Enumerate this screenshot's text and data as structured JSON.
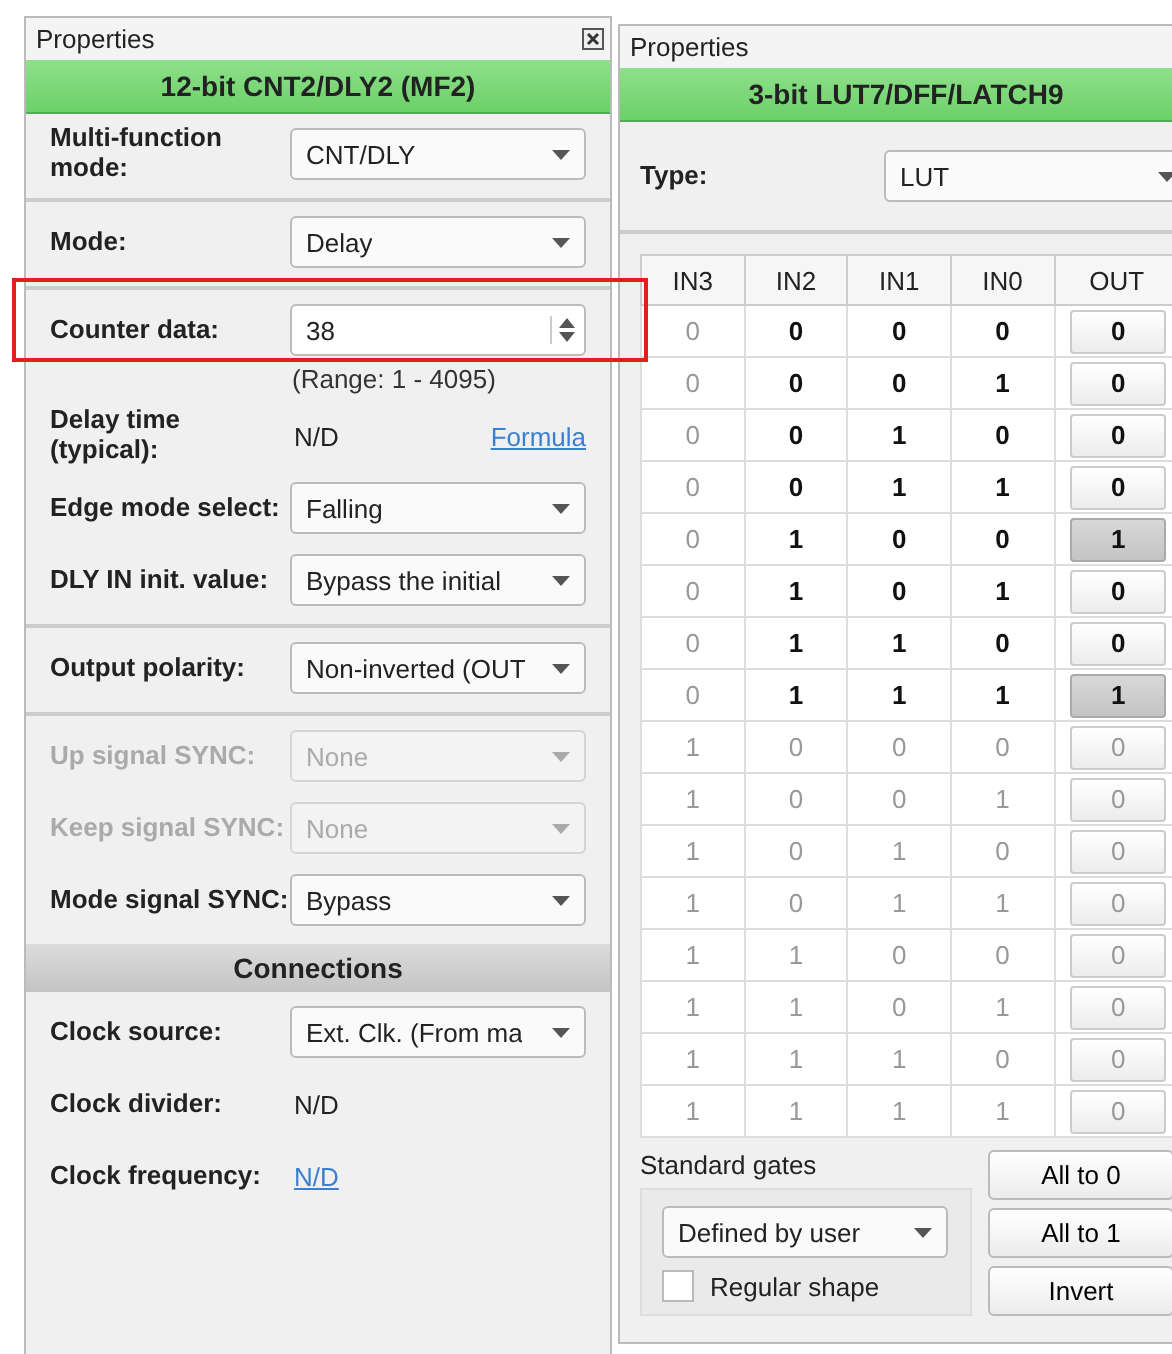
{
  "left_panel": {
    "title": "Properties",
    "header": "12-bit CNT2/DLY2 (MF2)",
    "groups": [
      {
        "fields": [
          {
            "kind": "dropdown",
            "label": "Multi-function mode:",
            "value": "CNT/DLY",
            "disabled": false
          }
        ]
      },
      {
        "fields": [
          {
            "kind": "dropdown",
            "label": "Mode:",
            "value": "Delay",
            "disabled": false
          }
        ]
      },
      {
        "fields": [
          {
            "kind": "spinbox",
            "label": "Counter data:",
            "value": "38",
            "hint": "(Range:  1 - 4095)",
            "highlighted": true
          },
          {
            "kind": "readout",
            "label": "Delay time (typical):",
            "value": "N/D",
            "link": "Formula"
          },
          {
            "kind": "dropdown",
            "label": "Edge mode select:",
            "value": "Falling",
            "disabled": false
          },
          {
            "kind": "dropdown",
            "label": "DLY IN init. value:",
            "value": "Bypass the initial",
            "disabled": false
          }
        ]
      },
      {
        "fields": [
          {
            "kind": "dropdown",
            "label": "Output polarity:",
            "value": "Non-inverted (OUT",
            "disabled": false
          }
        ]
      },
      {
        "fields": [
          {
            "kind": "dropdown",
            "label": "Up signal SYNC:",
            "value": "None",
            "disabled": true
          },
          {
            "kind": "dropdown",
            "label": "Keep signal SYNC:",
            "value": "None",
            "disabled": true
          },
          {
            "kind": "dropdown",
            "label": "Mode signal SYNC:",
            "value": "Bypass",
            "disabled": false
          }
        ]
      },
      {
        "heading": "Connections",
        "fields": [
          {
            "kind": "dropdown",
            "label": "Clock source:",
            "value": "Ext. Clk. (From ma",
            "disabled": false
          },
          {
            "kind": "readout",
            "label": "Clock divider:",
            "value": "N/D"
          },
          {
            "kind": "link",
            "label": "Clock frequency:",
            "value": "N/D"
          }
        ]
      }
    ]
  },
  "right_panel": {
    "title": "Properties",
    "header": "3-bit LUT7/DFF/LATCH9",
    "type_label": "Type:",
    "type_value": "LUT",
    "table": {
      "columns": [
        "IN3",
        "IN2",
        "IN1",
        "IN0",
        "OUT"
      ],
      "rows": [
        {
          "inputs": [
            "0",
            "0",
            "0",
            "0"
          ],
          "out": "0",
          "on": false,
          "active": true
        },
        {
          "inputs": [
            "0",
            "0",
            "0",
            "1"
          ],
          "out": "0",
          "on": false,
          "active": true
        },
        {
          "inputs": [
            "0",
            "0",
            "1",
            "0"
          ],
          "out": "0",
          "on": false,
          "active": true
        },
        {
          "inputs": [
            "0",
            "0",
            "1",
            "1"
          ],
          "out": "0",
          "on": false,
          "active": true
        },
        {
          "inputs": [
            "0",
            "1",
            "0",
            "0"
          ],
          "out": "1",
          "on": true,
          "active": true
        },
        {
          "inputs": [
            "0",
            "1",
            "0",
            "1"
          ],
          "out": "0",
          "on": false,
          "active": true
        },
        {
          "inputs": [
            "0",
            "1",
            "1",
            "0"
          ],
          "out": "0",
          "on": false,
          "active": true
        },
        {
          "inputs": [
            "0",
            "1",
            "1",
            "1"
          ],
          "out": "1",
          "on": true,
          "active": true
        },
        {
          "inputs": [
            "1",
            "0",
            "0",
            "0"
          ],
          "out": "0",
          "on": false,
          "active": false
        },
        {
          "inputs": [
            "1",
            "0",
            "0",
            "1"
          ],
          "out": "0",
          "on": false,
          "active": false
        },
        {
          "inputs": [
            "1",
            "0",
            "1",
            "0"
          ],
          "out": "0",
          "on": false,
          "active": false
        },
        {
          "inputs": [
            "1",
            "0",
            "1",
            "1"
          ],
          "out": "0",
          "on": false,
          "active": false
        },
        {
          "inputs": [
            "1",
            "1",
            "0",
            "0"
          ],
          "out": "0",
          "on": false,
          "active": false
        },
        {
          "inputs": [
            "1",
            "1",
            "0",
            "1"
          ],
          "out": "0",
          "on": false,
          "active": false
        },
        {
          "inputs": [
            "1",
            "1",
            "1",
            "0"
          ],
          "out": "0",
          "on": false,
          "active": false
        },
        {
          "inputs": [
            "1",
            "1",
            "1",
            "1"
          ],
          "out": "0",
          "on": false,
          "active": false
        }
      ]
    },
    "standard_gates": {
      "label": "Standard gates",
      "value": "Defined by user",
      "checkbox": {
        "label": "Regular shape",
        "checked": false
      }
    },
    "buttons": [
      "All to 0",
      "All to 1",
      "Invert"
    ]
  }
}
